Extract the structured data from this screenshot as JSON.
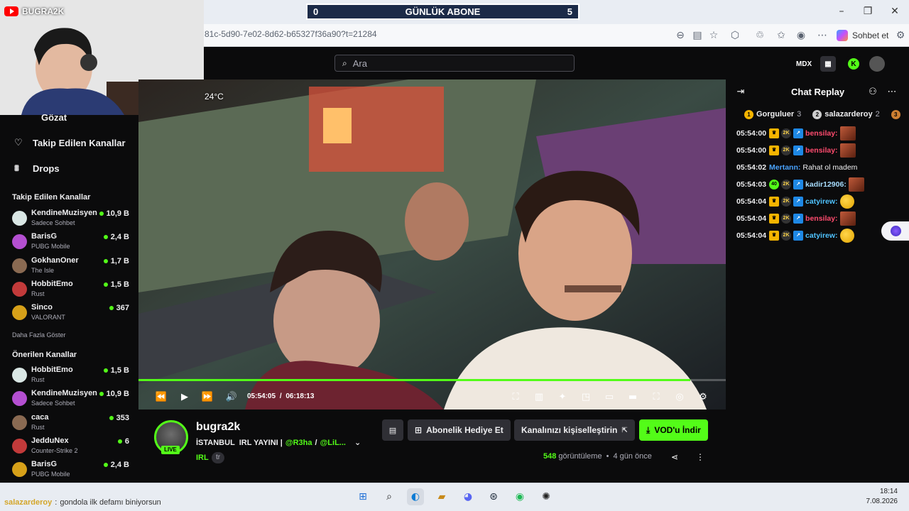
{
  "overlay": {
    "channel_logo_text": "BUGRA2K",
    "daily_sub_label": "GÜNLÜK ABONE",
    "daily_sub_left": "0",
    "daily_sub_right": "5",
    "weather": "24°C"
  },
  "browser": {
    "url": "81c-5d90-7e02-8d62-b65327f36a90?t=21284",
    "copilot_label": "Sohbet et"
  },
  "header": {
    "search_placeholder": "Ara"
  },
  "sidebar": {
    "nav": [
      {
        "label": "Gözat"
      },
      {
        "label": "Takip Edilen Kanallar"
      },
      {
        "label": "Drops"
      }
    ],
    "followed_title": "Takip Edilen Kanallar",
    "followed": [
      {
        "name": "KendineMuzisyen",
        "game": "Sadece Sohbet",
        "viewers": "10,9 B"
      },
      {
        "name": "BarisG",
        "game": "PUBG Mobile",
        "viewers": "2,4 B"
      },
      {
        "name": "GokhanOner",
        "game": "The Isle",
        "viewers": "1,7 B"
      },
      {
        "name": "HobbitEmo",
        "game": "Rust",
        "viewers": "1,5 B"
      },
      {
        "name": "Sinco",
        "game": "VALORANT",
        "viewers": "367"
      }
    ],
    "show_more": "Daha Fazla Göster",
    "recommended_title": "Önerilen Kanallar",
    "recommended": [
      {
        "name": "HobbitEmo",
        "game": "Rust",
        "viewers": "1,5 B"
      },
      {
        "name": "KendineMuzisyen",
        "game": "Sadece Sohbet",
        "viewers": "10,9 B"
      },
      {
        "name": "caca",
        "game": "Rust",
        "viewers": "353"
      },
      {
        "name": "JedduNex",
        "game": "Counter-Strike 2",
        "viewers": "6"
      },
      {
        "name": "BarisG",
        "game": "PUBG Mobile",
        "viewers": "2,4 B"
      }
    ]
  },
  "player": {
    "current_time": "05:54:05",
    "separator": "/",
    "duration": "06:18:13",
    "progress": 0.94
  },
  "stream": {
    "channel": "bugra2k",
    "live_badge": "LIVE",
    "title_plain": "İSTANBUL  IRL YAYINI |",
    "title_mention1": "@R3ha",
    "title_slash": "/",
    "title_mention2": "@LiL...",
    "category": "IRL",
    "language": "tr",
    "gift_sub_label": "Abonelik Hediye Et",
    "customize_label": "Kanalınızı kişiselleştirin",
    "vod_label": "VOD'u İndir",
    "views_count": "548",
    "views_label": "görüntüleme",
    "age": "4 gün önce"
  },
  "chat": {
    "title": "Chat Replay",
    "gifters": [
      {
        "rank": "1",
        "name": "Gorguluer",
        "count": "3",
        "color": "#f5b400"
      },
      {
        "rank": "2",
        "name": "salazarderoy",
        "count": "2",
        "color": "#cfcfcf"
      },
      {
        "rank": "3",
        "name": "",
        "count": "",
        "color": "#cd7f32"
      }
    ],
    "messages": [
      {
        "time": "05:54:00",
        "user": "bensilay:",
        "color": "#ff4b6e",
        "text": "",
        "emote": "face"
      },
      {
        "time": "05:54:00",
        "user": "bensilay:",
        "color": "#ff4b6e",
        "text": "",
        "emote": "face"
      },
      {
        "time": "05:54:02",
        "user": "Mertann:",
        "color": "#4aa3ff",
        "text": "Rahat ol madem",
        "emote": ""
      },
      {
        "time": "05:54:03",
        "user": "kadir12906:",
        "color": "#a7ddff",
        "text": "",
        "emote": "face"
      },
      {
        "time": "05:54:04",
        "user": "catyirew:",
        "color": "#4fc3ff",
        "text": "",
        "emote": "laugh"
      },
      {
        "time": "05:54:04",
        "user": "bensilay:",
        "color": "#ff4b6e",
        "text": "",
        "emote": "face"
      },
      {
        "time": "05:54:04",
        "user": "catyirew:",
        "color": "#4fc3ff",
        "text": "",
        "emote": "laugh"
      }
    ]
  },
  "overlay_chat": {
    "user": "salazarderoy",
    "separator": ":",
    "text": "gondola ilk defamı biniyorsun"
  },
  "taskbar": {
    "time": "18:14",
    "date": "7.08.2026"
  },
  "colors": {
    "accent": "#53fc18",
    "bg": "#0b0b0c"
  }
}
